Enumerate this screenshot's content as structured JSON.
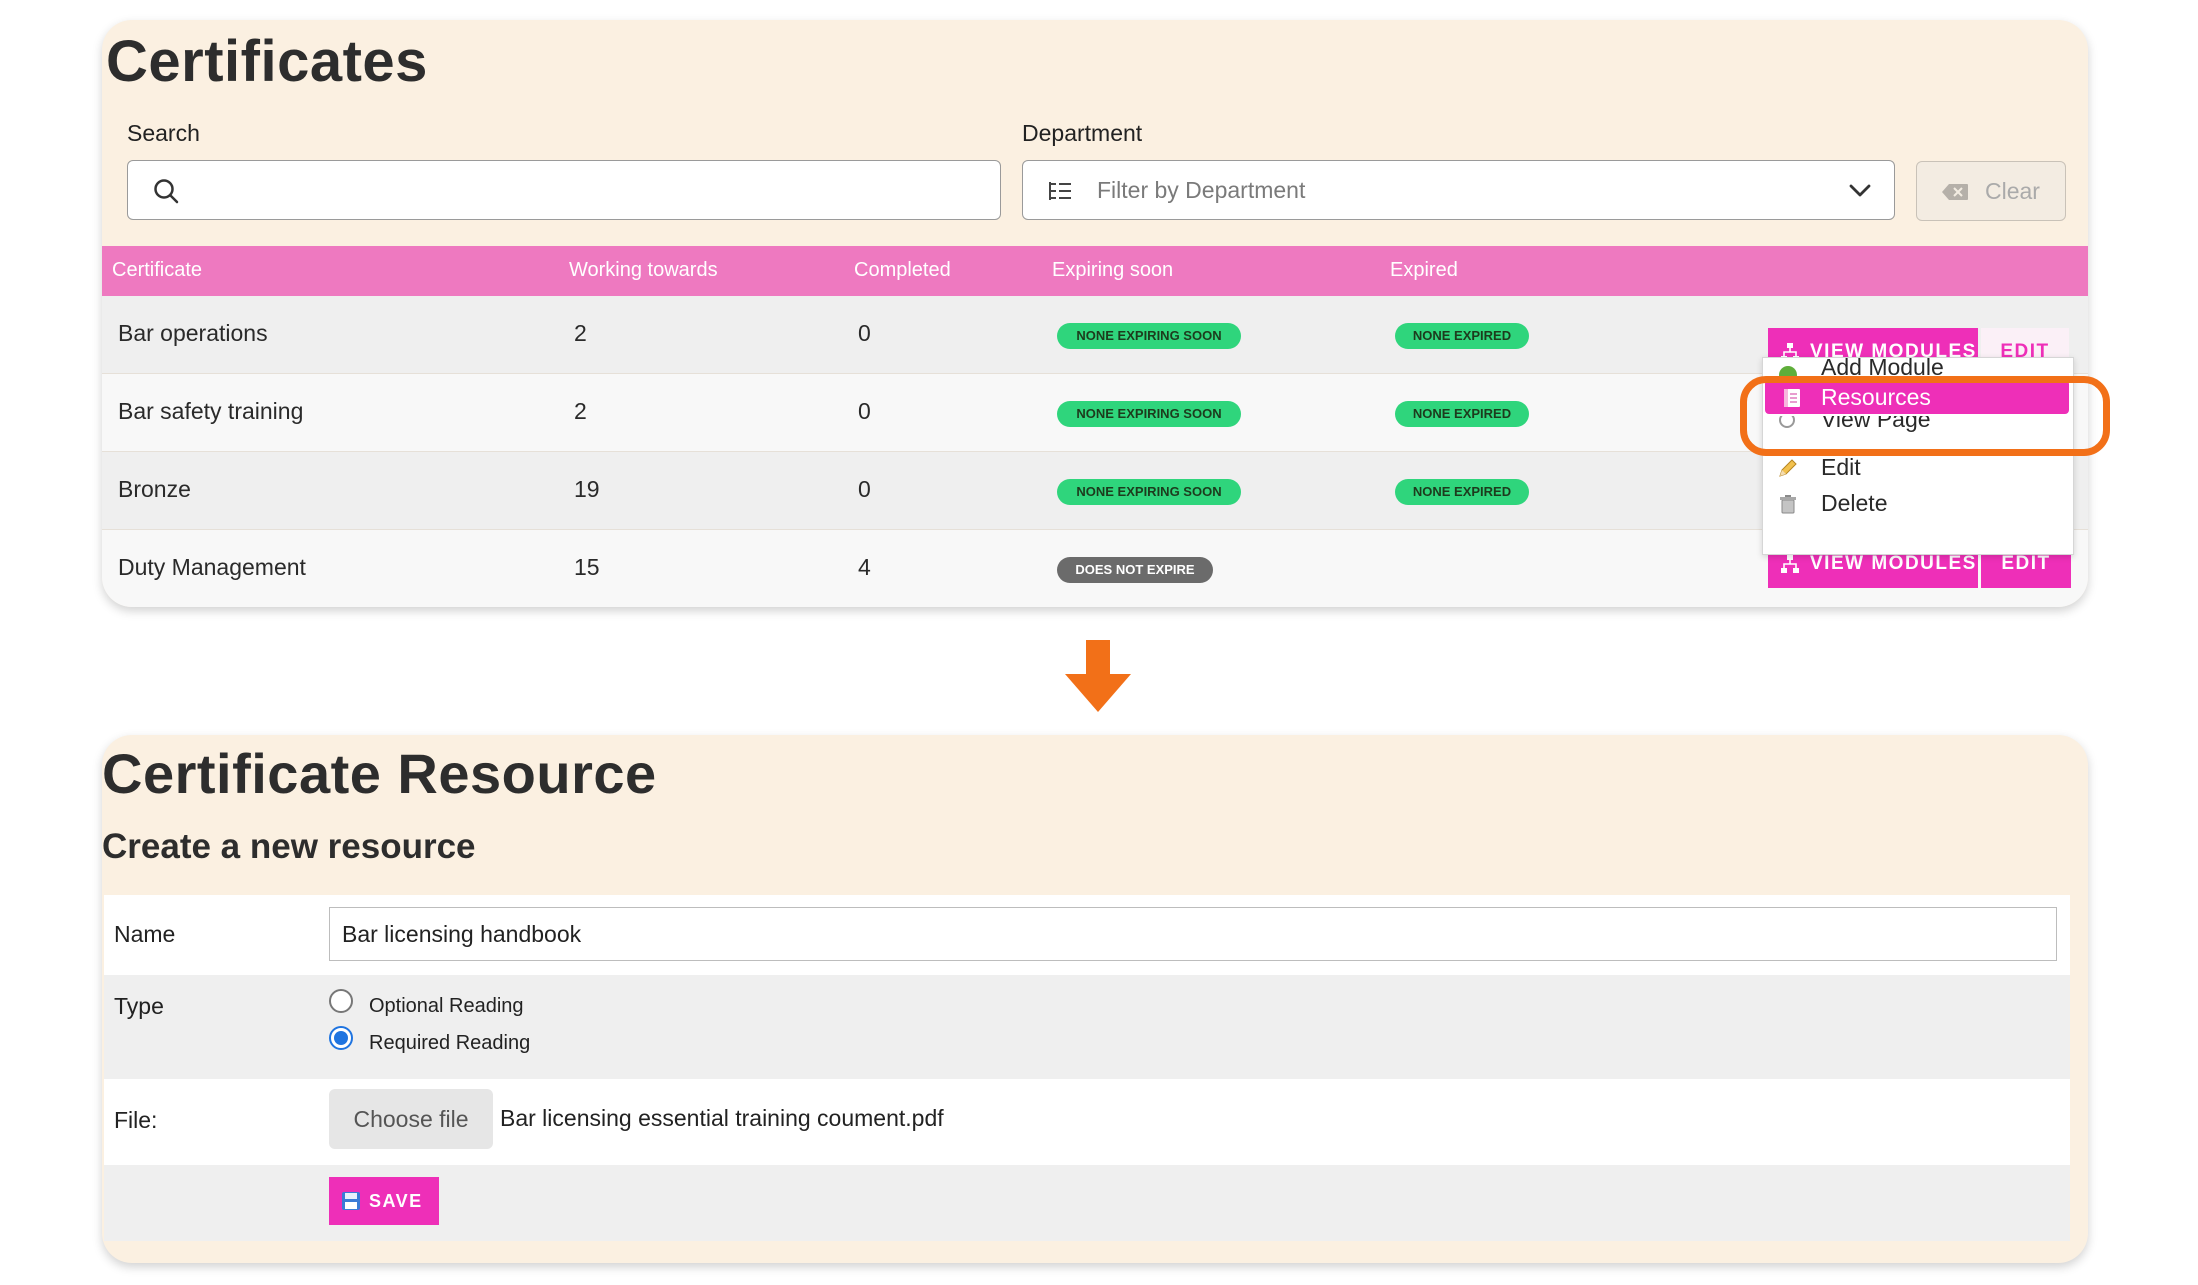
{
  "certificates_panel": {
    "title": "Certificates",
    "search_label": "Search",
    "search_value": "",
    "department_label": "Department",
    "department_placeholder": "Filter by Department",
    "clear_label": "Clear",
    "columns": [
      "Certificate",
      "Working towards",
      "Completed",
      "Expiring soon",
      "Expired"
    ],
    "rows": [
      {
        "name": "Bar operations",
        "working": "2",
        "completed": "0",
        "expiring": "NONE EXPIRING SOON",
        "expired": "NONE EXPIRED"
      },
      {
        "name": "Bar safety training",
        "working": "2",
        "completed": "0",
        "expiring": "NONE EXPIRING SOON",
        "expired": "NONE EXPIRED"
      },
      {
        "name": "Bronze",
        "working": "19",
        "completed": "0",
        "expiring": "NONE EXPIRING SOON",
        "expired": "NONE EXPIRED"
      },
      {
        "name": "Duty Management",
        "working": "15",
        "completed": "4",
        "expiring": "DOES NOT EXPIRE",
        "expired": ""
      }
    ],
    "view_modules_label": "VIEW MODULES",
    "edit_label": "EDIT",
    "dropdown": {
      "items": [
        "Add Module",
        "Resources",
        "View Page",
        "Edit",
        "Delete"
      ],
      "active_item": "Resources"
    },
    "badge_colors": {
      "green": "#2fd57c",
      "grey": "#6b6b6b"
    },
    "accent_color": "#ee2fb8",
    "header_color": "#ee79c0",
    "highlight_color": "#f27018"
  },
  "resource_panel": {
    "title": "Certificate Resource",
    "subtitle": "Create a new resource",
    "name_label": "Name",
    "name_value": "Bar licensing handbook",
    "type_label": "Type",
    "type_options": [
      "Optional Reading",
      "Required Reading"
    ],
    "type_selected": "Required Reading",
    "file_label": "File:",
    "choose_file_label": "Choose file",
    "file_name": "Bar licensing essential training coument.pdf",
    "save_label": "SAVE"
  }
}
